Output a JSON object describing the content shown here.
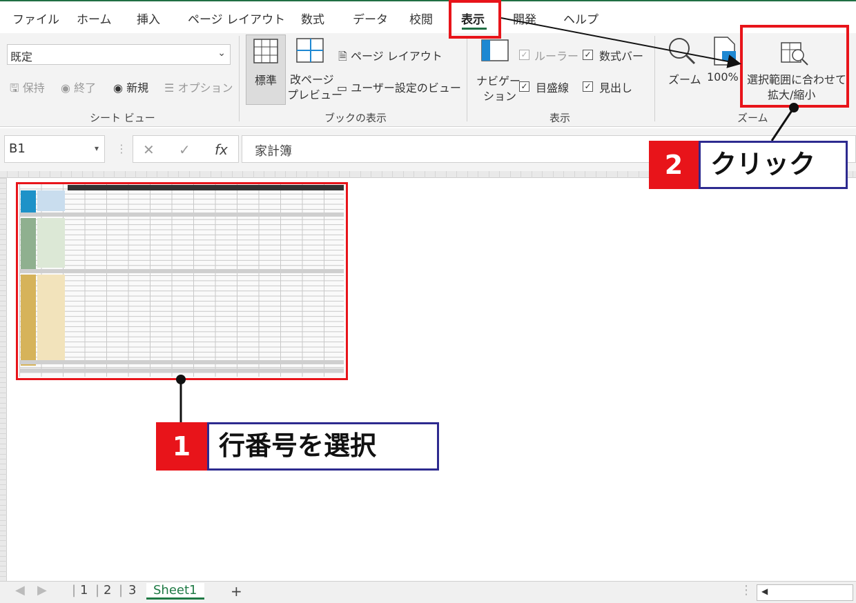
{
  "ribbon": {
    "tabs": [
      "ファイル",
      "ホーム",
      "挿入",
      "ページ レイアウト",
      "数式",
      "データ",
      "校閲",
      "表示",
      "開発",
      "ヘルプ"
    ],
    "active_tab": "表示",
    "sheet_view": {
      "selected": "既定",
      "keep": "保持",
      "exit": "終了",
      "new": "新規",
      "options": "オプション",
      "group": "シート ビュー"
    },
    "workbook_views": {
      "normal": "標準",
      "page_break_1": "改ページ",
      "page_break_2": "プレビュー",
      "page_layout": "ページ レイアウト",
      "custom_views": "ユーザー設定のビュー",
      "group": "ブックの表示"
    },
    "show": {
      "navigation_1": "ナビゲー",
      "navigation_2": "ション",
      "ruler": "ルーラー",
      "formula_bar": "数式バー",
      "gridlines": "目盛線",
      "headings": "見出し",
      "group": "表示"
    },
    "zoom": {
      "zoom": "ズーム",
      "hundred": "100%",
      "zoom_to_selection_1": "選択範囲に合わせて",
      "zoom_to_selection_2": "拡大/縮小",
      "group": "ズーム"
    }
  },
  "formula_bar": {
    "name_box": "B1",
    "cancel": "✕",
    "enter": "✓",
    "fx": "fx",
    "content": "家計簿"
  },
  "annotations": {
    "step1_num": "1",
    "step1_text": "行番号を選択",
    "step2_num": "2",
    "step2_text": "クリック"
  },
  "sheet_tabs": {
    "tabs": [
      "1",
      "2",
      "3"
    ],
    "active": "Sheet1",
    "add": "+"
  },
  "colors": {
    "excel_green": "#1f6e43",
    "highlight_red": "#e8141a",
    "label_border": "#2d2a8f"
  }
}
